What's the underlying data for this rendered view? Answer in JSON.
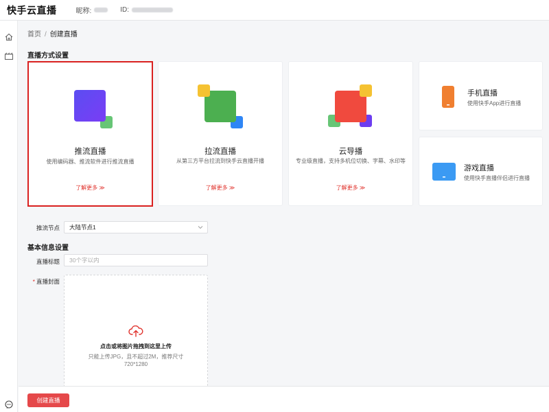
{
  "header": {
    "logo": "快手云直播",
    "nickname_label": "昵称:",
    "id_label": "ID:"
  },
  "breadcrumb": {
    "home": "首页",
    "separator": "/",
    "current": "创建直播"
  },
  "section_live_mode": "直播方式设置",
  "modes": [
    {
      "name": "推流直播",
      "desc": "使用编码器、推流软件进行推流直播",
      "more": "了解更多 ≫",
      "selected": true
    },
    {
      "name": "拉流直播",
      "desc": "从第三方平台拉流到快手云直播开播",
      "more": "了解更多 ≫"
    },
    {
      "name": "云导播",
      "desc": "专业级直播，支持多机位切换、字幕、水印等",
      "more": "了解更多 ≫"
    },
    {
      "name": "手机直播",
      "desc": "使用快手App进行直播"
    },
    {
      "name": "游戏直播",
      "desc": "使用快手直播伴侣进行直播"
    }
  ],
  "push_node": {
    "label": "推流节点",
    "value": "大陆节点1"
  },
  "section_basic_info": "基本信息设置",
  "live_title": {
    "label": "直播标题",
    "placeholder": "30个字以内"
  },
  "cover": {
    "required_mark": "*",
    "label": "直播封面",
    "upload_text": "点击或将图片拖拽到这里上传",
    "hint_line1": "只能上传JPG，且不超过2M，推荐尺寸",
    "hint_line2": "720*1280"
  },
  "footer": {
    "create_button": "创建直播"
  },
  "colors": {
    "accent": "#e0302a",
    "selected_border": "#d9201f",
    "button": "#e5484a"
  },
  "icons": [
    "home-icon",
    "video-icon",
    "chat-icon",
    "chevron-down-icon",
    "cloud-upload-icon"
  ]
}
